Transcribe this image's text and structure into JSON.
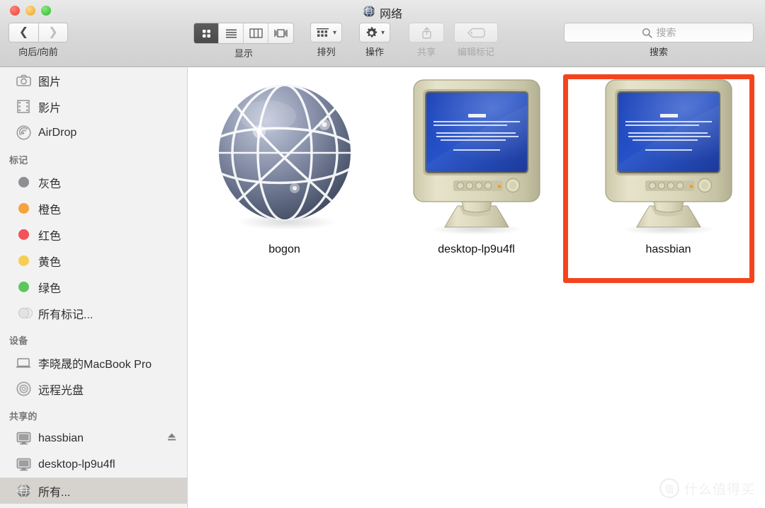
{
  "window": {
    "title": "网络",
    "title_icon": "globe-icon",
    "traffic_lights": [
      {
        "name": "close",
        "color": "#e8453c"
      },
      {
        "name": "minimize",
        "color": "#e9a52c"
      },
      {
        "name": "zoom",
        "color": "#30b830"
      }
    ]
  },
  "toolbar": {
    "nav": {
      "label": "向后/向前",
      "back_icon": "chevron-left-icon",
      "forward_icon": "chevron-right-icon",
      "back_enabled": true,
      "forward_enabled": false
    },
    "view": {
      "label": "显示",
      "modes": [
        {
          "name": "icon-view",
          "icon": "grid-icon",
          "selected": true
        },
        {
          "name": "list-view",
          "icon": "list-icon",
          "selected": false
        },
        {
          "name": "column-view",
          "icon": "columns-icon",
          "selected": false
        },
        {
          "name": "coverflow-view",
          "icon": "coverflow-icon",
          "selected": false
        }
      ]
    },
    "arrange": {
      "label": "排列",
      "icon": "arrange-grid-icon",
      "caret": "⌄",
      "enabled": true
    },
    "action": {
      "label": "操作",
      "icon": "gear-icon",
      "caret": "⌄",
      "enabled": true
    },
    "share": {
      "label": "共享",
      "icon": "share-icon",
      "enabled": false
    },
    "edit_tags": {
      "label": "编辑标记",
      "icon": "tag-icon",
      "enabled": false
    },
    "search": {
      "label": "搜索",
      "placeholder": "搜索",
      "value": "",
      "icon": "search-icon"
    }
  },
  "sidebar": {
    "sections": [
      {
        "header": "",
        "items": [
          {
            "label": "图片",
            "icon": "camera-icon",
            "selected": false
          },
          {
            "label": "影片",
            "icon": "film-icon",
            "selected": false
          },
          {
            "label": "AirDrop",
            "icon": "airdrop-icon",
            "selected": false
          }
        ]
      },
      {
        "header": "标记",
        "items": [
          {
            "label": "灰色",
            "icon": "tag-dot",
            "color": "#8e8e93",
            "selected": false
          },
          {
            "label": "橙色",
            "icon": "tag-dot",
            "color": "#f5a33c",
            "selected": false
          },
          {
            "label": "红色",
            "icon": "tag-dot",
            "color": "#f2525a",
            "selected": false
          },
          {
            "label": "黄色",
            "icon": "tag-dot",
            "color": "#f5ce54",
            "selected": false
          },
          {
            "label": "绿色",
            "icon": "tag-dot",
            "color": "#5dc75d",
            "selected": false
          },
          {
            "label": "所有标记...",
            "icon": "all-tags-icon",
            "color": "#e3e3e3",
            "selected": false
          }
        ]
      },
      {
        "header": "设备",
        "items": [
          {
            "label": "李晓晟的MacBook Pro",
            "icon": "laptop-icon",
            "selected": false
          },
          {
            "label": "远程光盘",
            "icon": "disc-icon",
            "selected": false
          }
        ]
      },
      {
        "header": "共享的",
        "items": [
          {
            "label": "hassbian",
            "icon": "display-icon",
            "selected": false,
            "eject": true
          },
          {
            "label": "desktop-lp9u4fl",
            "icon": "display-icon",
            "selected": false,
            "eject": false
          },
          {
            "label": "所有...",
            "icon": "globe-icon",
            "selected": true,
            "eject": false
          }
        ]
      }
    ]
  },
  "content": {
    "items": [
      {
        "label": "bogon",
        "icon": "network-globe-icon",
        "selected": false
      },
      {
        "label": "desktop-lp9u4fl",
        "icon": "windows-pc-icon",
        "selected": false
      },
      {
        "label": "hassbian",
        "icon": "windows-pc-icon",
        "selected": false,
        "annotated": true
      }
    ],
    "annotation": {
      "color": "#f4441e",
      "target": "hassbian"
    }
  },
  "watermark": {
    "badge": "值",
    "text": "什么值得买"
  }
}
